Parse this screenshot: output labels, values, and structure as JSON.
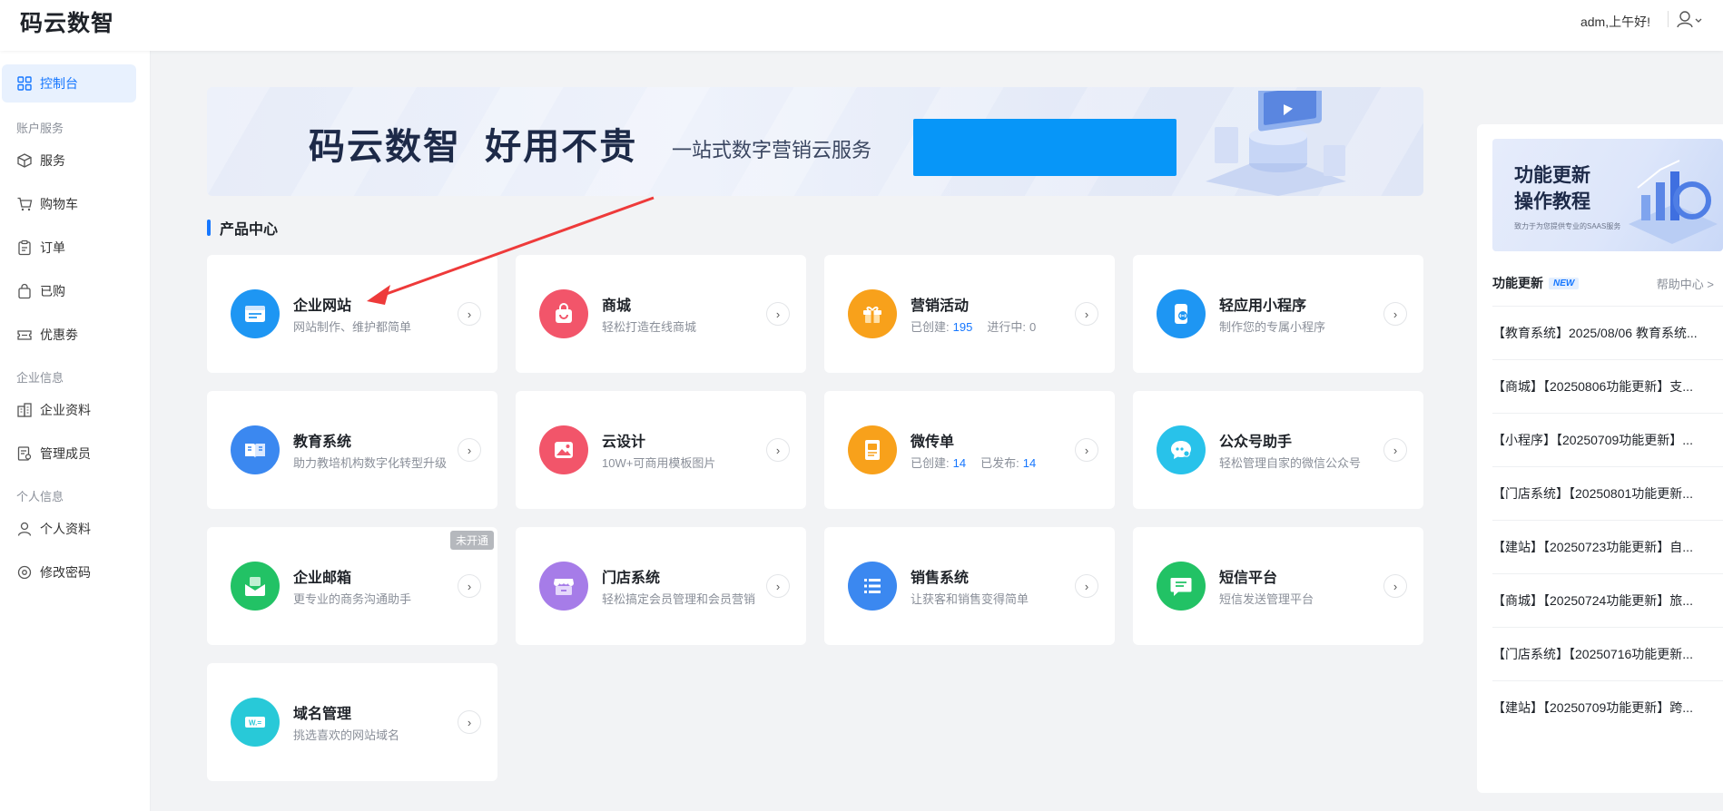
{
  "header": {
    "logo": "码云数智",
    "greeting": "adm,上午好!"
  },
  "sidebar": {
    "dashboard": "控制台",
    "groups": [
      {
        "label": "账户服务",
        "items": [
          "服务",
          "购物车",
          "订单",
          "已购",
          "优惠劵"
        ]
      },
      {
        "label": "企业信息",
        "items": [
          "企业资料",
          "管理成员"
        ]
      },
      {
        "label": "个人信息",
        "items": [
          "个人资料",
          "修改密码"
        ]
      }
    ]
  },
  "banner": {
    "title": "码云数智  好用不贵",
    "subtitle": "一站式数字营销云服务"
  },
  "section_title": "产品中心",
  "products": [
    {
      "name": "企业网站",
      "desc": "网站制作、维护都简单",
      "color": "#1e96f3",
      "icon": "website-icon"
    },
    {
      "name": "商城",
      "desc": "轻松打造在线商城",
      "color": "#f2556a",
      "icon": "shopping-bag-icon"
    },
    {
      "name": "营销活动",
      "desc_label1": "已创建:",
      "num1": "195",
      "desc_label2": "进行中:",
      "num2": "0",
      "color": "#f8a11b",
      "icon": "gift-icon"
    },
    {
      "name": "轻应用小程序",
      "desc": "制作您的专属小程序",
      "color": "#1e96f3",
      "icon": "miniapp-icon"
    },
    {
      "name": "教育系统",
      "desc": "助力教培机构数字化转型升级",
      "color": "#3b88f0",
      "icon": "book-icon"
    },
    {
      "name": "云设计",
      "desc": "10W+可商用模板图片",
      "color": "#f2556a",
      "icon": "image-icon"
    },
    {
      "name": "微传单",
      "desc_label1": "已创建:",
      "num1": "14",
      "desc_label2": "已发布:",
      "num2": "14",
      "color": "#f8a11b",
      "icon": "flyer-icon"
    },
    {
      "name": "公众号助手",
      "desc": "轻松管理自家的微信公众号",
      "color": "#28c2ea",
      "icon": "wechat-icon"
    },
    {
      "name": "企业邮箱",
      "desc": "更专业的商务沟通助手",
      "color": "#22c265",
      "icon": "mail-icon",
      "badge": "未开通"
    },
    {
      "name": "门店系统",
      "desc": "轻松搞定会员管理和会员营销",
      "color": "#a67ce8",
      "icon": "store-icon"
    },
    {
      "name": "销售系统",
      "desc": "让获客和销售变得简单",
      "color": "#3b88f0",
      "icon": "list-icon"
    },
    {
      "name": "短信平台",
      "desc": "短信发送管理平台",
      "color": "#22c265",
      "icon": "sms-icon"
    },
    {
      "name": "域名管理",
      "desc": "挑选喜欢的网站域名",
      "color": "#28c9d8",
      "icon": "domain-icon"
    }
  ],
  "right_panel": {
    "banner_title": "功能更新\n操作教程",
    "banner_small": "致力于为您提供专业的SAAS服务",
    "heading": "功能更新",
    "new_badge": "NEW",
    "help": "帮助中心 >",
    "items": [
      "【教育系统】2025/08/06 教育系统...",
      "【商城】【20250806功能更新】支...",
      "【小程序】【20250709功能更新】...",
      "【门店系统】【20250801功能更新...",
      "【建站】【20250723功能更新】自...",
      "【商城】【20250724功能更新】旅...",
      "【门店系统】【20250716功能更新...",
      "【建站】【20250709功能更新】跨..."
    ]
  }
}
